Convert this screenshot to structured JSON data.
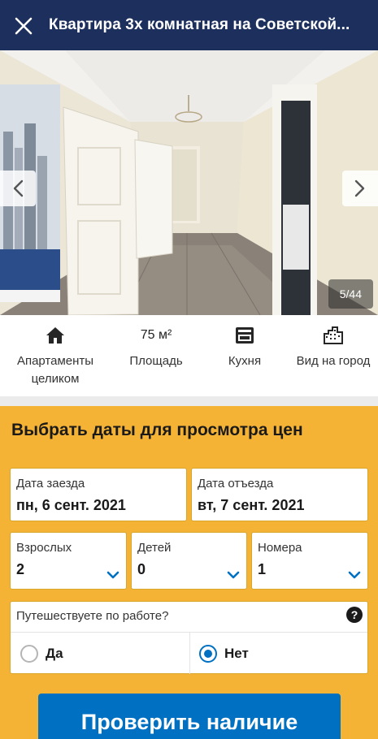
{
  "header": {
    "title": "Квартира 3х комнатная на Советской..."
  },
  "gallery": {
    "counter": "5/44"
  },
  "facilities": [
    {
      "icon": "house-icon",
      "label": "Апартаменты целиком"
    },
    {
      "icon": "",
      "label": "Площадь",
      "value": "75 м²"
    },
    {
      "icon": "kitchen-icon",
      "label": "Кухня"
    },
    {
      "icon": "city-view-icon",
      "label": "Вид на город"
    }
  ],
  "booking": {
    "heading": "Выбрать даты для просмотра цен",
    "checkin": {
      "label": "Дата заезда",
      "value": "пн, 6 сент. 2021"
    },
    "checkout": {
      "label": "Дата отъезда",
      "value": "вт, 7 сент. 2021"
    },
    "adults": {
      "label": "Взрослых",
      "value": "2"
    },
    "children": {
      "label": "Детей",
      "value": "0"
    },
    "rooms": {
      "label": "Номера",
      "value": "1"
    },
    "work_trip": {
      "question": "Путешествуете по работе?",
      "help": "?",
      "options": [
        {
          "label": "Да",
          "checked": false
        },
        {
          "label": "Нет",
          "checked": true
        }
      ]
    },
    "check_button": "Проверить наличие"
  },
  "colors": {
    "header_bg": "#1d2f5c",
    "booking_bg": "#f5b335",
    "primary": "#0071c2"
  }
}
